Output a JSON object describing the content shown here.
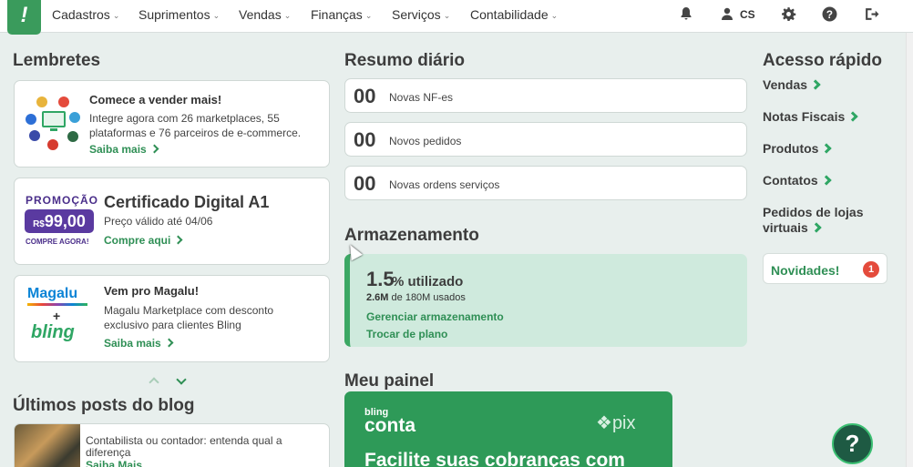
{
  "nav": {
    "logo": "!",
    "menu": [
      {
        "label": "Cadastros"
      },
      {
        "label": "Suprimentos"
      },
      {
        "label": "Vendas"
      },
      {
        "label": "Finanças"
      },
      {
        "label": "Serviços"
      },
      {
        "label": "Contabilidade"
      }
    ],
    "user_initials": "CS",
    "icons": [
      "bell-icon",
      "user-icon",
      "gear-icon",
      "help-icon",
      "logout-icon"
    ]
  },
  "reminders": {
    "heading": "Lembretes",
    "marketplaces": {
      "title": "Comece a vender mais!",
      "text": "Integre agora com 26 marketplaces, 55 plataformas e 76 parceiros de e-commerce.",
      "link": "Saiba mais"
    },
    "certificate": {
      "promo_tag": "PROMOÇÃO",
      "promo_currency": "R$",
      "promo_price": "99,00",
      "promo_cta": "COMPRE AGORA!",
      "title": "Certificado Digital A1",
      "text": "Preço válido até 04/06",
      "link": "Compre aqui"
    },
    "magalu": {
      "brand": "Magalu",
      "plus": "+",
      "bling": "bling",
      "title": "Vem pro Magalu!",
      "text": "Magalu Marketplace com desconto exclusivo para clientes Bling",
      "link": "Saiba mais"
    }
  },
  "blog": {
    "heading": "Últimos posts do blog",
    "post_title": "Contabilista ou contador: entenda qual a diferença",
    "post_link": "Saiba Mais"
  },
  "summary": {
    "heading": "Resumo diário",
    "items": [
      {
        "count": "00",
        "label": "Novas NF-es"
      },
      {
        "count": "00",
        "label": "Novos pedidos"
      },
      {
        "count": "00",
        "label": "Novas ordens serviços"
      }
    ]
  },
  "storage": {
    "heading": "Armazenamento",
    "percent": "1.5",
    "percent_label": "% utilizado",
    "used": "2.6M",
    "used_suffix": "de 180M usados",
    "manage_link": "Gerenciar armazenamento",
    "plan_link": "Trocar de plano"
  },
  "panel": {
    "heading": "Meu painel",
    "banner_brand": "bling",
    "banner_product": "conta",
    "banner_pix": "pix",
    "banner_headline": "Facilite suas cobranças com"
  },
  "quick_access": {
    "heading": "Acesso rápido",
    "links": [
      {
        "label": "Vendas"
      },
      {
        "label": "Notas Fiscais"
      },
      {
        "label": "Produtos"
      },
      {
        "label": "Contatos"
      },
      {
        "label": "Pedidos de lojas virtuais"
      }
    ],
    "news_label": "Novidades!",
    "news_count": "1"
  },
  "help_button": "?",
  "colors": {
    "brand_green": "#3a9b5c",
    "link_green": "#2f8f55",
    "background": "#e8efed",
    "storage_bg": "#cfeadd",
    "badge_red": "#e44b3c",
    "promo_purple": "#5a3aa0"
  }
}
